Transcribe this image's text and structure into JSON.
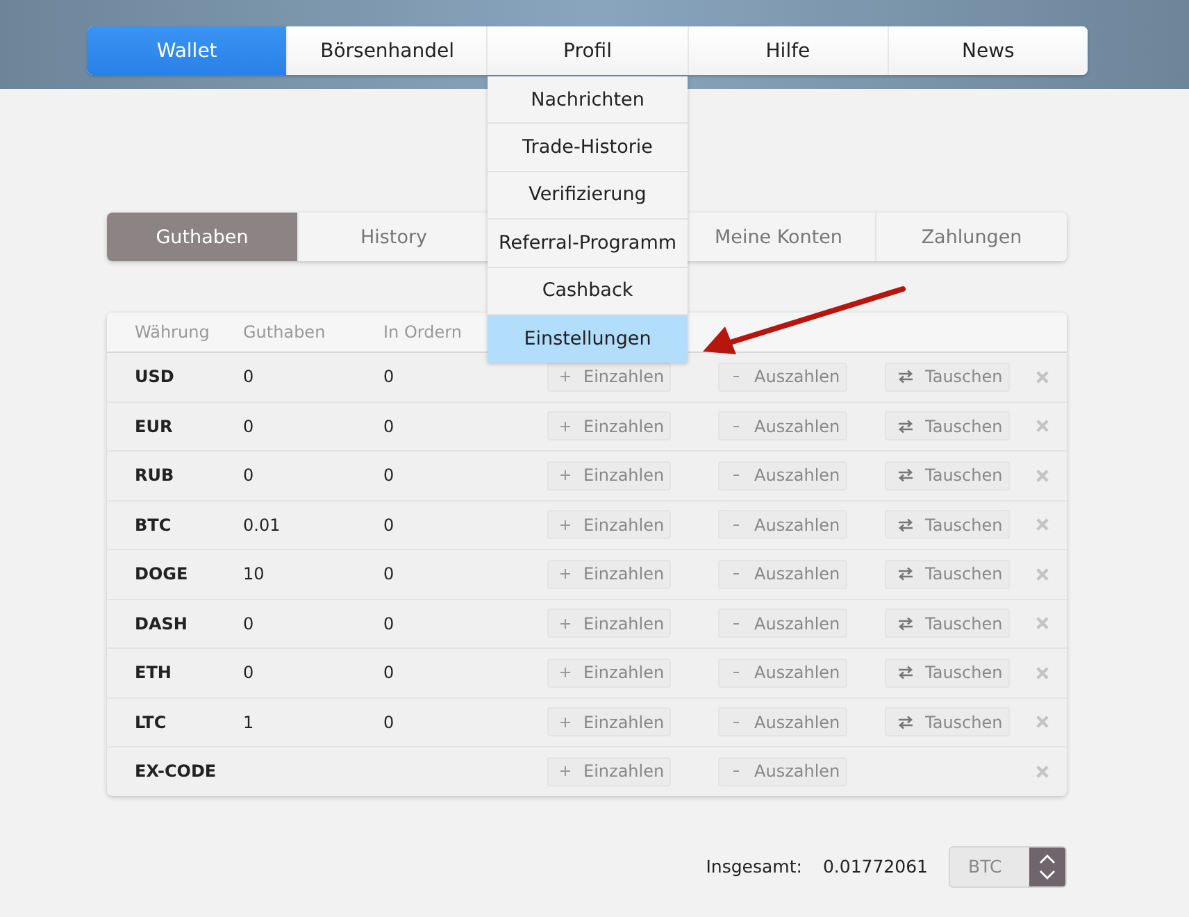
{
  "nav": [
    {
      "label": "Wallet",
      "selected": true
    },
    {
      "label": "Börsenhandel",
      "selected": false
    },
    {
      "label": "Profil",
      "selected": false
    },
    {
      "label": "Hilfe",
      "selected": false
    },
    {
      "label": "News",
      "selected": false
    }
  ],
  "profile_menu": [
    {
      "label": "Nachrichten",
      "selected": false
    },
    {
      "label": "Trade-Historie",
      "selected": false
    },
    {
      "label": "Verifizierung",
      "selected": false
    },
    {
      "label": "Referral-Programm",
      "selected": false
    },
    {
      "label": "Cashback",
      "selected": false
    },
    {
      "label": "Einstellungen",
      "selected": true
    }
  ],
  "tabs": [
    {
      "label": "Guthaben",
      "selected": true
    },
    {
      "label": "History",
      "selected": false
    },
    {
      "label": "Meine Konten",
      "selected": false
    },
    {
      "label": "Zahlungen",
      "selected": false
    }
  ],
  "table": {
    "columns": [
      "Währung",
      "Guthaben",
      "In Ordern"
    ],
    "rows": [
      {
        "currency": "USD",
        "balance": "0",
        "in_orders": "0",
        "deposit": "Einzahlen",
        "withdraw": "Auszahlen",
        "exchange": "Tauschen"
      },
      {
        "currency": "EUR",
        "balance": "0",
        "in_orders": "0",
        "deposit": "Einzahlen",
        "withdraw": "Auszahlen",
        "exchange": "Tauschen"
      },
      {
        "currency": "RUB",
        "balance": "0",
        "in_orders": "0",
        "deposit": "Einzahlen",
        "withdraw": "Auszahlen",
        "exchange": "Tauschen"
      },
      {
        "currency": "BTC",
        "balance": "0.01",
        "in_orders": "0",
        "deposit": "Einzahlen",
        "withdraw": "Auszahlen",
        "exchange": "Tauschen"
      },
      {
        "currency": "DOGE",
        "balance": "10",
        "in_orders": "0",
        "deposit": "Einzahlen",
        "withdraw": "Auszahlen",
        "exchange": "Tauschen"
      },
      {
        "currency": "DASH",
        "balance": "0",
        "in_orders": "0",
        "deposit": "Einzahlen",
        "withdraw": "Auszahlen",
        "exchange": "Tauschen"
      },
      {
        "currency": "ETH",
        "balance": "0",
        "in_orders": "0",
        "deposit": "Einzahlen",
        "withdraw": "Auszahlen",
        "exchange": "Tauschen"
      },
      {
        "currency": "LTC",
        "balance": "1",
        "in_orders": "0",
        "deposit": "Einzahlen",
        "withdraw": "Auszahlen",
        "exchange": "Tauschen"
      },
      {
        "currency": "EX-CODE",
        "deposit": "Einzahlen",
        "withdraw": "Auszahlen"
      }
    ]
  },
  "total": {
    "label": "Insgesamt:",
    "value": "0.01772061",
    "unit": "BTC"
  }
}
